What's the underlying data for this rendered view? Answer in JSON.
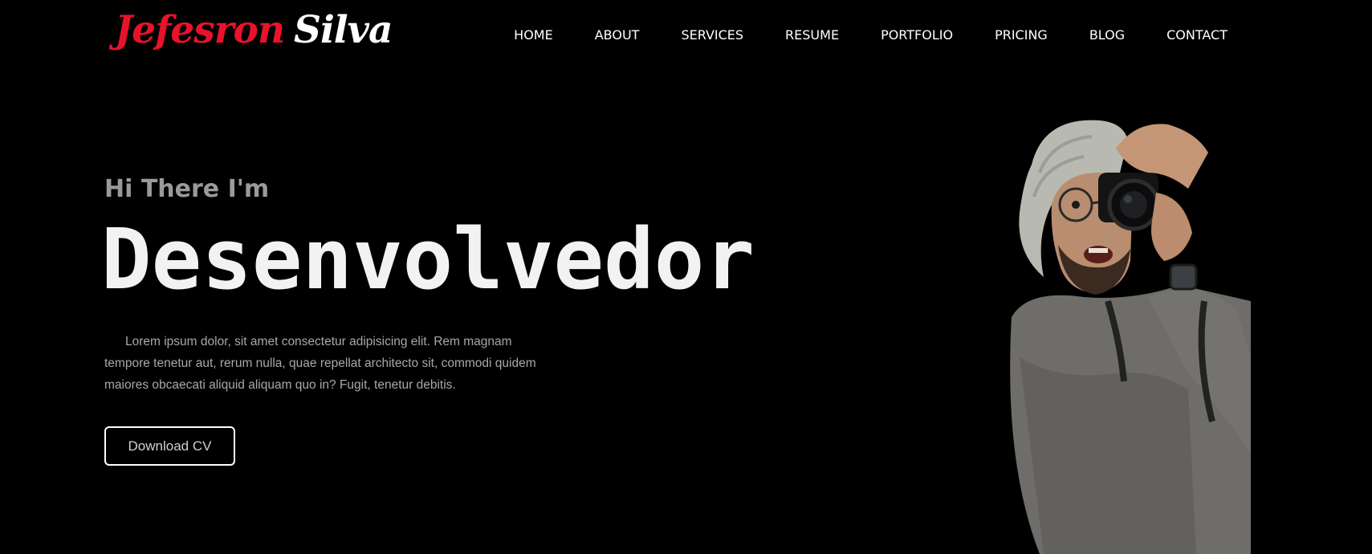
{
  "header": {
    "logo": {
      "first": "Jefesron",
      "last": "Silva"
    },
    "nav": [
      "HOME",
      "ABOUT",
      "SERVICES",
      "RESUME",
      "PORTFOLIO",
      "PRICING",
      "BLOG",
      "CONTACT"
    ]
  },
  "hero": {
    "greeting": "Hi There I'm",
    "headline": "Desenvolvedor",
    "intro": "Lorem ipsum dolor, sit amet consectetur adipisicing elit. Rem magnam tempore tenetur aut, rerum nulla, quae repellat architecto sit, commodi quidem maiores obcaecati aliquid aliquam quo in? Fugit, tenetur debitis.",
    "cv_button": "Download CV"
  },
  "colors": {
    "background": "#000000",
    "accent": "#e8132b",
    "text": "#ffffff",
    "muted": "#a8a8a8"
  },
  "icons": {
    "portrait": "photographer-with-camera-photo"
  }
}
